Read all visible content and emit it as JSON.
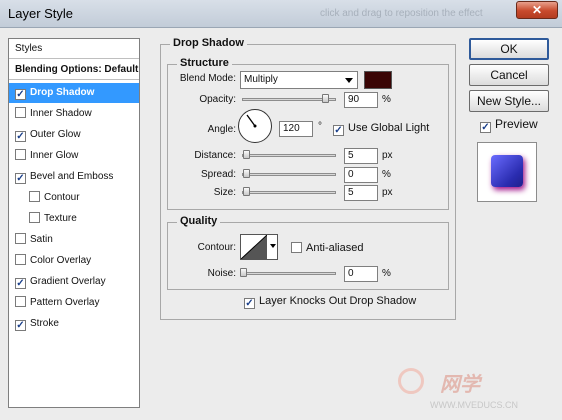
{
  "window": {
    "title": "Layer Style",
    "header_watermark": "click and drag to reposition the effect"
  },
  "style_list": {
    "header": "Styles",
    "blending": "Blending Options: Default",
    "items": [
      {
        "label": "Drop Shadow",
        "checked": true,
        "selected": true
      },
      {
        "label": "Inner Shadow",
        "checked": false
      },
      {
        "label": "Outer Glow",
        "checked": true
      },
      {
        "label": "Inner Glow",
        "checked": false
      },
      {
        "label": "Bevel and Emboss",
        "checked": true
      },
      {
        "label": "Contour",
        "checked": false,
        "sub": true
      },
      {
        "label": "Texture",
        "checked": false,
        "sub": true
      },
      {
        "label": "Satin",
        "checked": false
      },
      {
        "label": "Color Overlay",
        "checked": false
      },
      {
        "label": "Gradient Overlay",
        "checked": true
      },
      {
        "label": "Pattern Overlay",
        "checked": false
      },
      {
        "label": "Stroke",
        "checked": true
      }
    ]
  },
  "panel": {
    "title": "Drop Shadow",
    "structure": {
      "title": "Structure",
      "blend_mode_label": "Blend Mode:",
      "blend_mode": "Multiply",
      "shadow_color": "#3a0505",
      "opacity_label": "Opacity:",
      "opacity": "90",
      "opacity_unit": "%",
      "angle_label": "Angle:",
      "angle": "120",
      "angle_unit": "°",
      "use_global_light": "Use Global Light",
      "use_global_light_checked": true,
      "distance_label": "Distance:",
      "distance": "5",
      "distance_unit": "px",
      "spread_label": "Spread:",
      "spread": "0",
      "spread_unit": "%",
      "size_label": "Size:",
      "size": "5",
      "size_unit": "px"
    },
    "quality": {
      "title": "Quality",
      "contour_label": "Contour:",
      "anti_aliased": "Anti-aliased",
      "anti_aliased_checked": false,
      "noise_label": "Noise:",
      "noise": "0",
      "noise_unit": "%"
    },
    "layer_knocks_out": "Layer Knocks Out Drop Shadow",
    "layer_knocks_out_checked": true
  },
  "buttons": {
    "ok": "OK",
    "cancel": "Cancel",
    "new_style": "New Style...",
    "preview_label": "Preview",
    "preview_checked": true
  },
  "footer_watermark": "WWW.MVEDUCS.CN",
  "footer_brand": "网学"
}
